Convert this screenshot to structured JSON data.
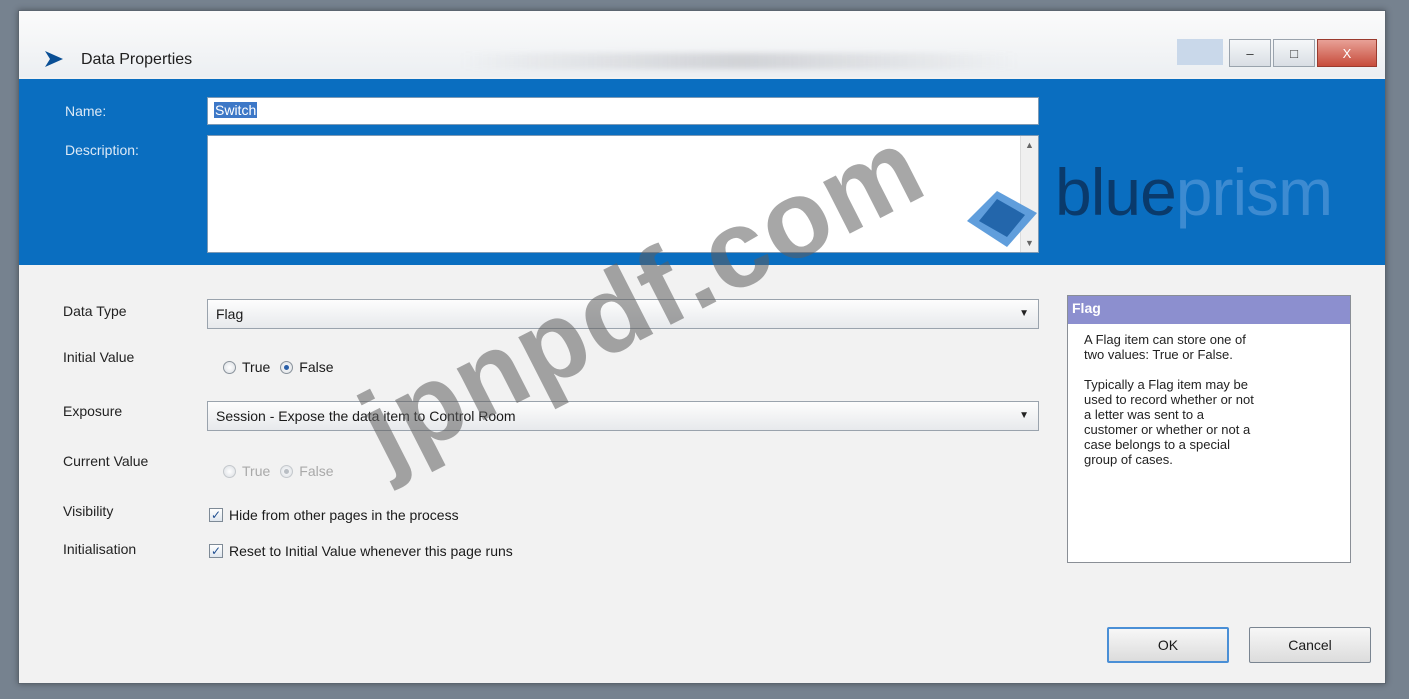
{
  "window": {
    "title": "Data Properties",
    "controls": {
      "minimize": "–",
      "maximize": "□",
      "close": "X"
    }
  },
  "header": {
    "name_label": "Name:",
    "name_value": "Switch",
    "description_label": "Description:",
    "description_value": "",
    "brand_primary": "blue",
    "brand_secondary": "prism"
  },
  "form": {
    "data_type_label": "Data Type",
    "data_type_value": "Flag",
    "initial_value_label": "Initial Value",
    "initial_true": "True",
    "initial_false": "False",
    "initial_selected": "False",
    "exposure_label": "Exposure",
    "exposure_value": "Session - Expose the data item to Control Room",
    "current_value_label": "Current Value",
    "current_true": "True",
    "current_false": "False",
    "visibility_label": "Visibility",
    "visibility_option": "Hide from other pages in the process",
    "visibility_checked": true,
    "initialisation_label": "Initialisation",
    "initialisation_option": "Reset to Initial Value whenever this page runs",
    "initialisation_checked": true
  },
  "help": {
    "title": "Flag",
    "text": "A Flag item can store one of\ntwo values: True or False.\n\nTypically a Flag item may be\nused to record whether or not\na letter was sent to a\ncustomer or whether or not a\ncase belongs to a special\ngroup of cases."
  },
  "buttons": {
    "ok": "OK",
    "cancel": "Cancel"
  },
  "watermark": "jpnpdf.com",
  "colors": {
    "header_blue": "#0a6ec0",
    "help_title": "#8c8fcf",
    "selection": "#3d78c7"
  }
}
